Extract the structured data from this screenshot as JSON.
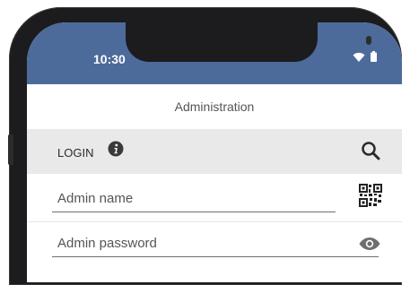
{
  "status_bar": {
    "time": "10:30"
  },
  "header": {
    "title": "Administration"
  },
  "login_section": {
    "label": "LOGIN"
  },
  "form": {
    "admin_name": {
      "placeholder": "Admin name"
    },
    "admin_password": {
      "placeholder": "Admin password"
    }
  },
  "icons": [
    "info-icon",
    "search-icon",
    "qr-code-icon",
    "eye-icon",
    "wifi-icon",
    "battery-icon"
  ],
  "colors": {
    "status_bar_bg": "#4d6b9a",
    "login_bar_bg": "#e9e9ea"
  }
}
